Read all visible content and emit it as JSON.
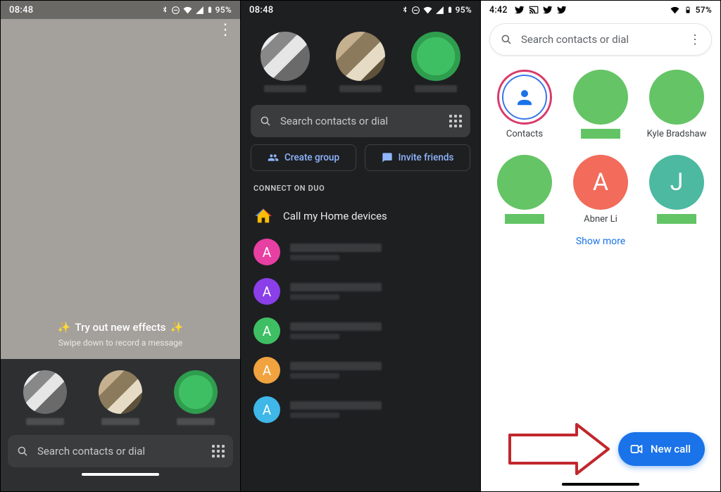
{
  "panel1": {
    "status": {
      "time": "08:48",
      "battery": "95%"
    },
    "effects_title": "Try out new effects",
    "swipe_hint": "Swipe down to record a message",
    "search_placeholder": "Search contacts or dial"
  },
  "panel2": {
    "status": {
      "time": "08:48",
      "battery": "95%"
    },
    "search_placeholder": "Search contacts or dial",
    "create_group": "Create group",
    "invite_friends": "Invite friends",
    "section_label": "CONNECT ON DUO",
    "home_item": "Call my Home devices",
    "contacts": [
      {
        "initial": "A",
        "color": "#e83fa3"
      },
      {
        "initial": "A",
        "color": "#8a3fe8"
      },
      {
        "initial": "A",
        "color": "#3fbf63"
      },
      {
        "initial": "A",
        "color": "#f0a33f"
      },
      {
        "initial": "A",
        "color": "#3fb7e8"
      }
    ]
  },
  "panel3": {
    "status": {
      "time": "4:42",
      "battery": "57%"
    },
    "search_placeholder": "Search contacts or dial",
    "grid": [
      {
        "kind": "contacts",
        "label": "Contacts"
      },
      {
        "kind": "green-redacted",
        "label": ""
      },
      {
        "kind": "green",
        "label": "Kyle Bradshaw"
      },
      {
        "kind": "green-redacted",
        "label": ""
      },
      {
        "kind": "red-initial",
        "initial": "A",
        "label": "Abner Li"
      },
      {
        "kind": "teal-initial",
        "initial": "J",
        "label": ""
      }
    ],
    "show_more": "Show more",
    "fab": "New call"
  }
}
